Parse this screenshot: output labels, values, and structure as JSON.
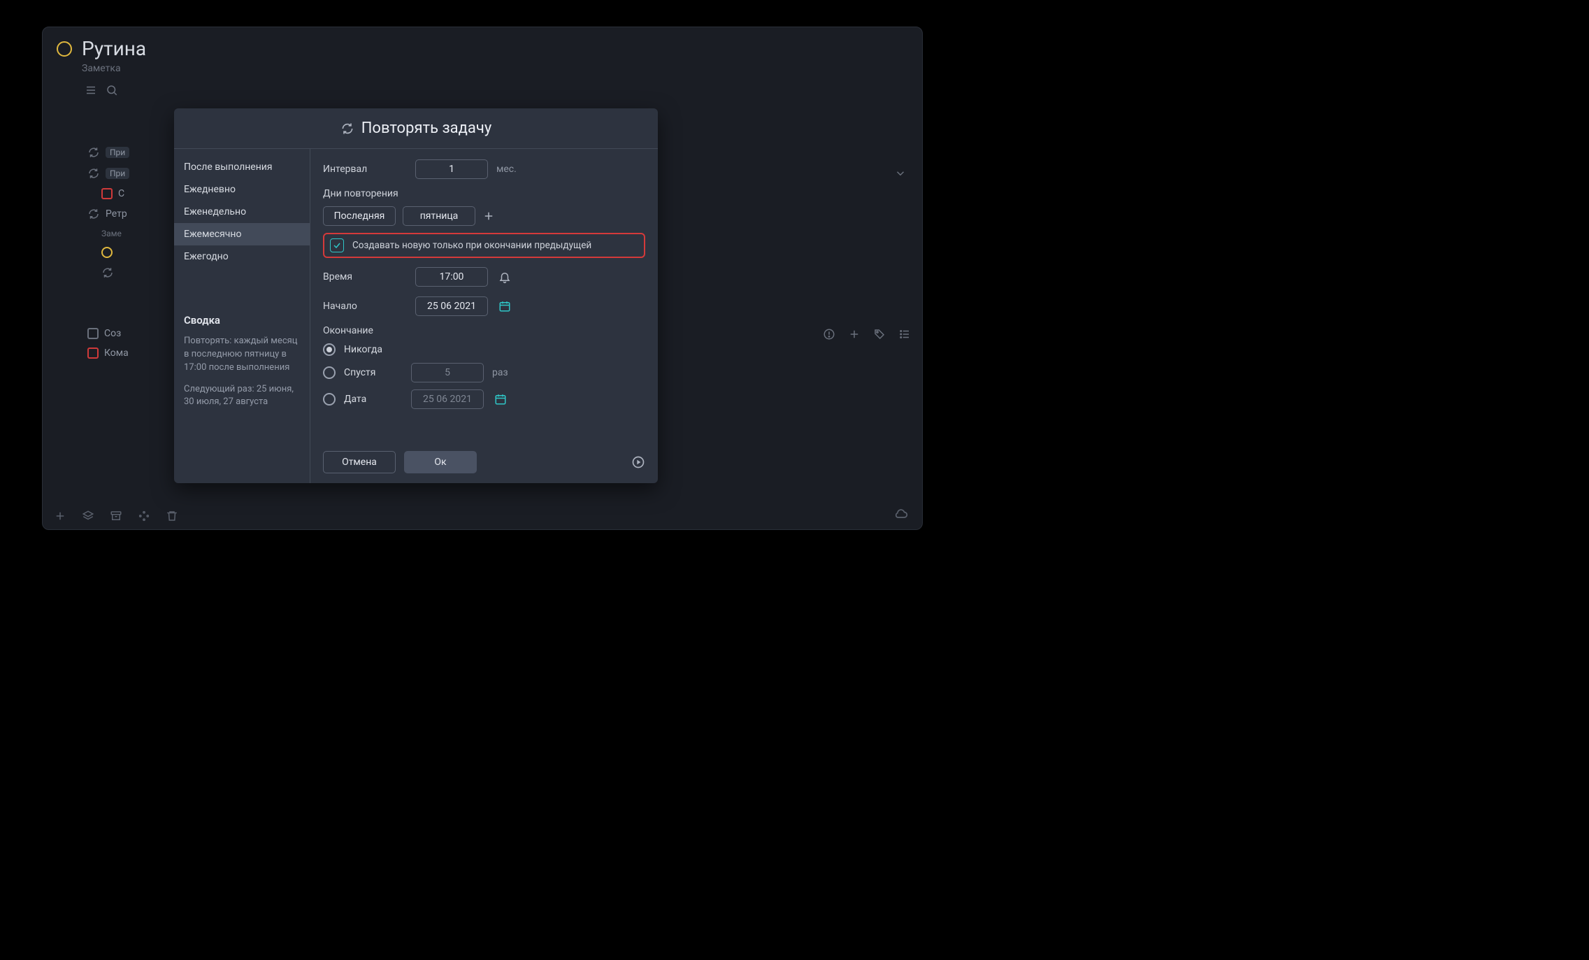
{
  "window": {
    "title": "Рутина",
    "subtitle": "Заметка"
  },
  "background": {
    "items": {
      "pri1": "При",
      "pri2": "При",
      "c": "C",
      "retr": "Ретр",
      "zam": "Заме",
      "soz": "Соз",
      "kom": "Кома"
    }
  },
  "modal": {
    "title": "Повторять задачу",
    "side": {
      "items": [
        "После выполнения",
        "Ежедневно",
        "Еженедельно",
        "Ежемесячно",
        "Ежегодно"
      ],
      "active_index": 3,
      "summary_h": "Сводка",
      "summary_text": "Повторять: каждый месяц в последнюю пятницу в 17:00 после выполнения",
      "next_text": "Следующий раз: 25 июня, 30 июля, 27 августа"
    },
    "main": {
      "interval_label": "Интервал",
      "interval_value": "1",
      "interval_unit": "мес.",
      "days_label": "Дни повторения",
      "chip1": "Последняя",
      "chip2": "пятница",
      "checkbox_label": "Создавать новую только при окончании предыдущей",
      "checkbox_checked": true,
      "time_label": "Время",
      "time_value": "17:00",
      "start_label": "Начало",
      "start_value": "25 06 2021",
      "end_label": "Окончание",
      "end_options": {
        "never": "Никогда",
        "after": "Спустя",
        "after_value": "5",
        "after_unit": "раз",
        "date": "Дата",
        "date_value": "25 06 2021"
      },
      "end_selected": "never",
      "cancel": "Отмена",
      "ok": "Ок"
    }
  }
}
